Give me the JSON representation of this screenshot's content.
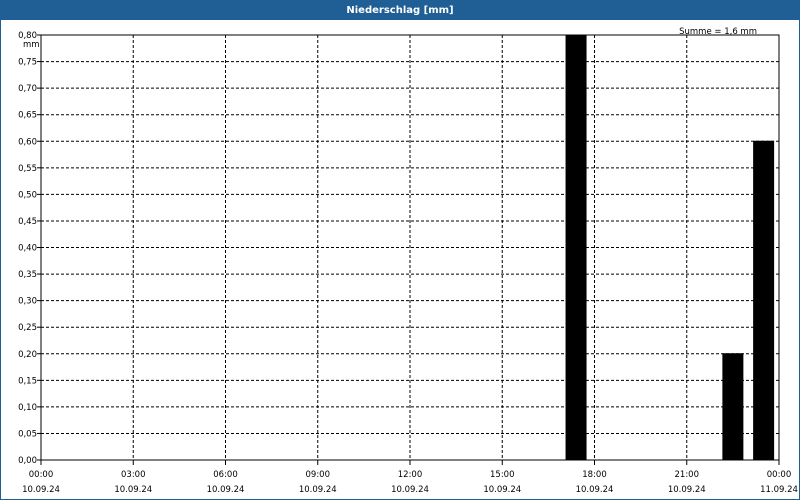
{
  "window": {
    "title": "Niederschlag [mm]"
  },
  "colors": {
    "titlebar": "#1f5f95",
    "bars": "#000000"
  },
  "chart_data": {
    "type": "bar",
    "ylabel": "mm",
    "ylim": [
      0,
      0.8
    ],
    "yticks": [
      "0,00",
      "0,05",
      "0,10",
      "0,15",
      "0,20",
      "0,25",
      "0,30",
      "0,35",
      "0,40",
      "0,45",
      "0,50",
      "0,55",
      "0,60",
      "0,65",
      "0,70",
      "0,75",
      "0,80"
    ],
    "xticks": [
      {
        "time": "00:00",
        "date": "10.09.24"
      },
      {
        "time": "03:00",
        "date": "10.09.24"
      },
      {
        "time": "06:00",
        "date": "10.09.24"
      },
      {
        "time": "09:00",
        "date": "10.09.24"
      },
      {
        "time": "12:00",
        "date": "10.09.24"
      },
      {
        "time": "15:00",
        "date": "10.09.24"
      },
      {
        "time": "18:00",
        "date": "10.09.24"
      },
      {
        "time": "21:00",
        "date": "10.09.24"
      },
      {
        "time": "00:00",
        "date": "11.09.24"
      }
    ],
    "xrange_hours": [
      0,
      24
    ],
    "grid": true,
    "annotation": "Summe = 1,6 mm",
    "bars": [
      {
        "hour": 17.4,
        "value": 0.8
      },
      {
        "hour": 22.5,
        "value": 0.2
      },
      {
        "hour": 23.5,
        "value": 0.6
      }
    ]
  }
}
